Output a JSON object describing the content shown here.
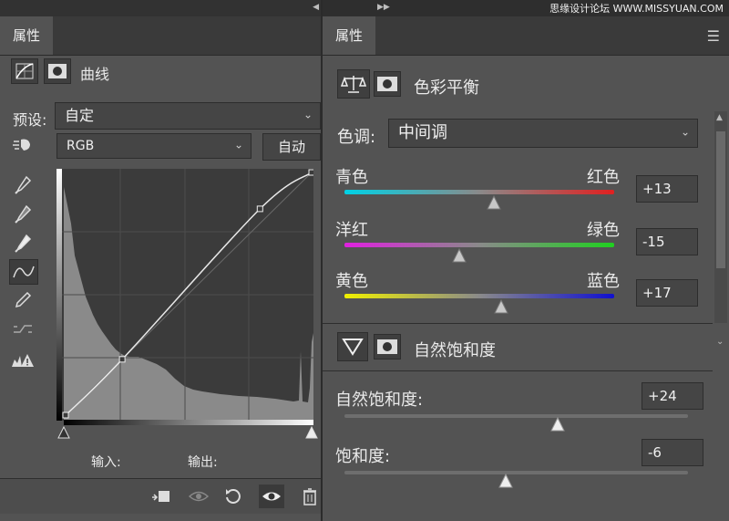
{
  "left_panel": {
    "tab": "属性",
    "title": "曲线",
    "preset_label": "预设:",
    "preset_value": "自定",
    "channel_value": "RGB",
    "auto_label": "自动",
    "input_label": "输入:",
    "output_label": "输出:",
    "curve_points": [
      [
        0,
        0
      ],
      [
        0.23,
        0.23
      ],
      [
        0.79,
        0.85
      ],
      [
        1,
        1
      ]
    ]
  },
  "right_panel": {
    "tab": "属性",
    "title": "色彩平衡",
    "tone_label": "色调:",
    "tone_value": "中间调",
    "sliders": [
      {
        "left": "青色",
        "right": "红色",
        "value": "+13",
        "level": 0.555
      },
      {
        "left": "洋红",
        "right": "绿色",
        "value": "-15",
        "level": 0.425
      },
      {
        "left": "黄色",
        "right": "蓝色",
        "value": "+17",
        "level": 0.58
      }
    ],
    "section2_title": "自然饱和度",
    "vibrance_label": "自然饱和度:",
    "vibrance_value": "+24",
    "vibrance_level": 0.62,
    "saturation_label": "饱和度:",
    "saturation_value": "-6",
    "saturation_level": 0.47
  },
  "watermark": "思缘设计论坛 WWW.MISSYUAN.COM",
  "colors": {
    "panel_bg": "#535353",
    "cyan": "#00d2e6",
    "red": "#e12020",
    "magenta": "#e020e0",
    "green": "#20d020",
    "yellow": "#f0f000",
    "blue": "#1010d0"
  }
}
